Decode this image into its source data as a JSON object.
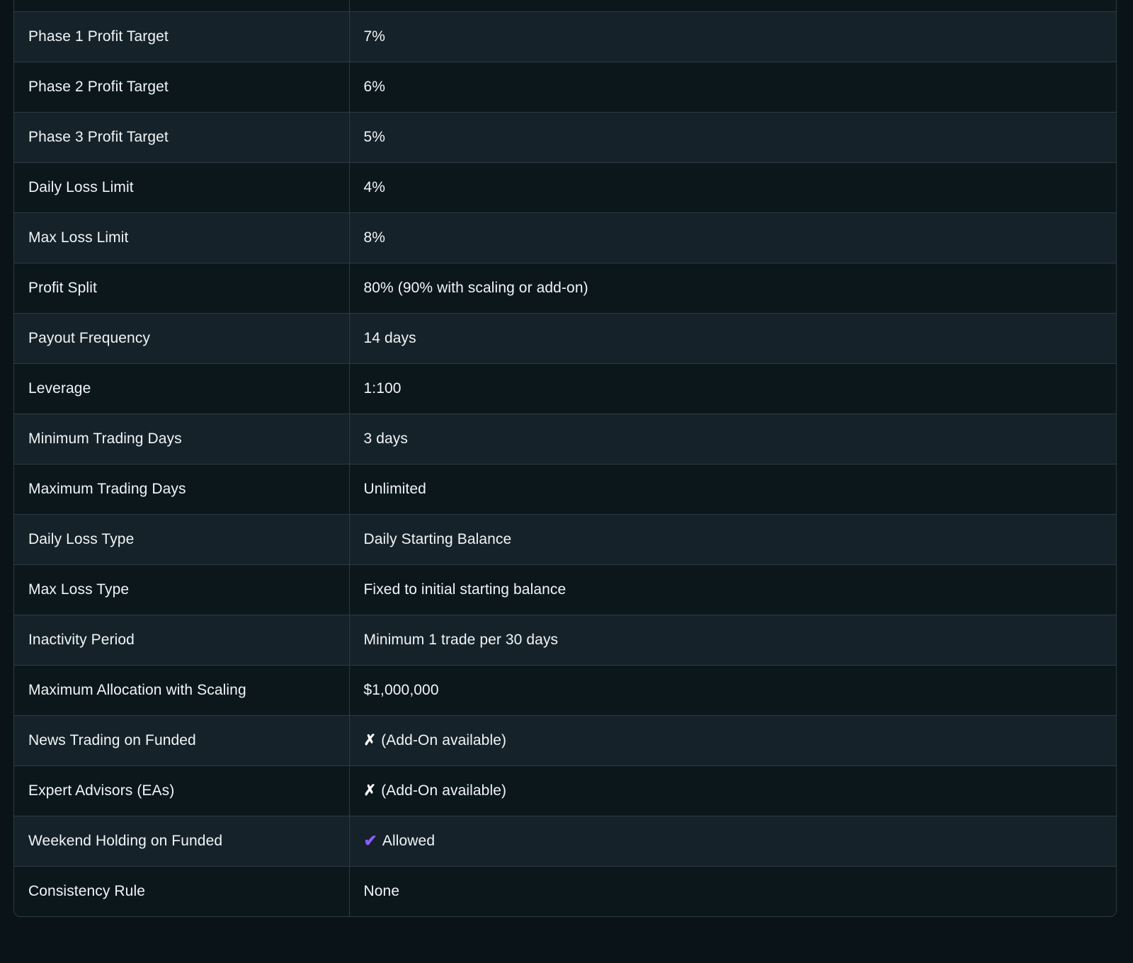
{
  "theme": {
    "page_background": "#0a1418",
    "table_background_odd": "#0c171c",
    "table_background_even": "#15222a",
    "border_color": "#2c3b42",
    "text_color": "#f1f5f6",
    "check_color": "#8b5cf6",
    "cross_color": "#ffffff"
  },
  "table": {
    "clipped_top_row": {
      "label": "",
      "value": ""
    },
    "rows": [
      {
        "label": "Phase 1 Profit Target",
        "value": "7%",
        "icon": ""
      },
      {
        "label": "Phase 2 Profit Target",
        "value": "6%",
        "icon": ""
      },
      {
        "label": "Phase 3 Profit Target",
        "value": "5%",
        "icon": ""
      },
      {
        "label": "Daily Loss Limit",
        "value": "4%",
        "icon": ""
      },
      {
        "label": "Max Loss Limit",
        "value": "8%",
        "icon": ""
      },
      {
        "label": "Profit Split",
        "value": "80% (90% with scaling or add-on)",
        "icon": ""
      },
      {
        "label": "Payout Frequency",
        "value": "14 days",
        "icon": ""
      },
      {
        "label": "Leverage",
        "value": "1:100",
        "icon": ""
      },
      {
        "label": "Minimum Trading Days",
        "value": "3 days",
        "icon": ""
      },
      {
        "label": "Maximum Trading Days",
        "value": "Unlimited",
        "icon": ""
      },
      {
        "label": "Daily Loss Type",
        "value": "Daily Starting Balance",
        "icon": ""
      },
      {
        "label": "Max Loss Type",
        "value": "Fixed to initial starting balance",
        "icon": ""
      },
      {
        "label": "Inactivity Period",
        "value": "Minimum 1 trade per 30 days",
        "icon": ""
      },
      {
        "label": "Maximum Allocation with Scaling",
        "value": "$1,000,000",
        "icon": ""
      },
      {
        "label": "News Trading on Funded",
        "value": "(Add-On available)",
        "icon": "cross-icon",
        "icon_glyph": "✗"
      },
      {
        "label": "Expert Advisors (EAs)",
        "value": "(Add-On available)",
        "icon": "cross-icon",
        "icon_glyph": "✗"
      },
      {
        "label": "Weekend Holding on Funded",
        "value": "Allowed",
        "icon": "check-icon",
        "icon_glyph": "✔"
      },
      {
        "label": "Consistency Rule",
        "value": "None",
        "icon": ""
      }
    ]
  }
}
